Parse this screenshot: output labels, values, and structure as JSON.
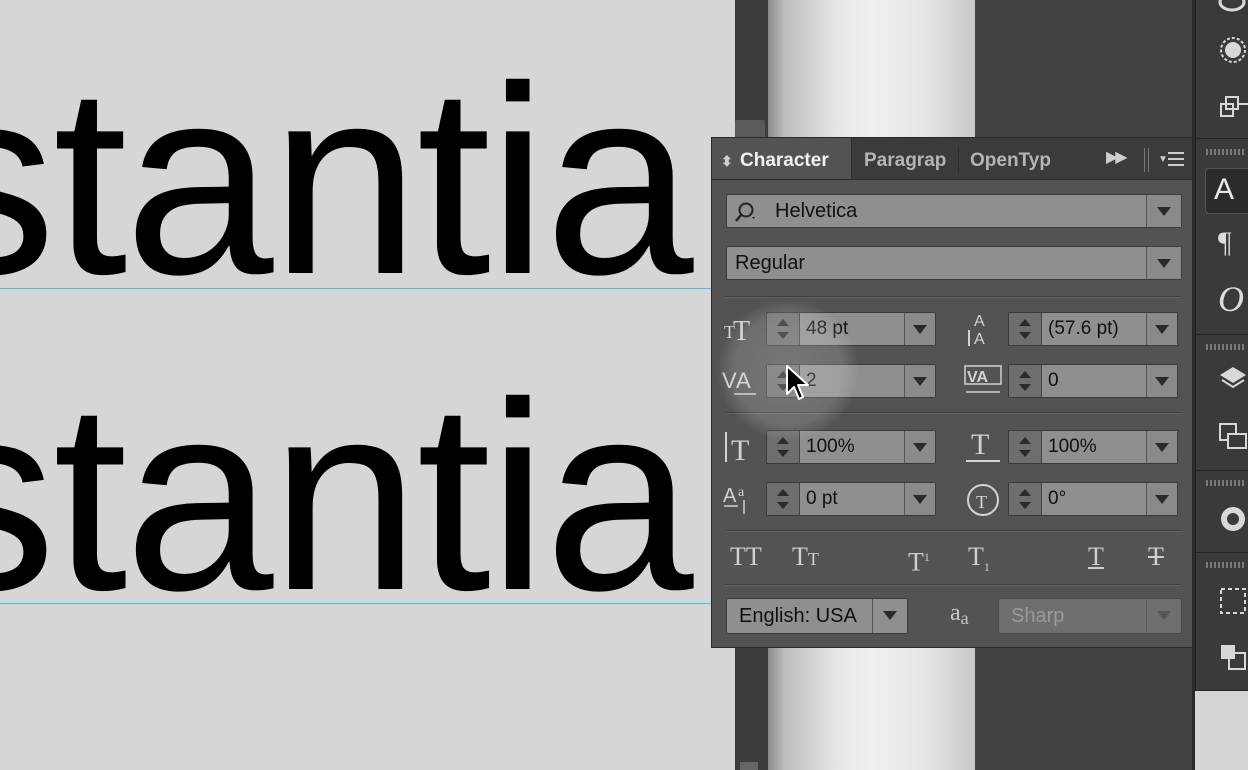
{
  "artboard": {
    "line1": "stantia",
    "line2": "stantia",
    "guide_color": "#3ec7d4"
  },
  "character_panel": {
    "tabs": {
      "character": "Character",
      "paragraph": "Paragrap",
      "opentype": "OpenTyp"
    },
    "font_family": "Helvetica",
    "font_style": "Regular",
    "font_size": "48 pt",
    "leading": "(57.6 pt)",
    "kerning": "2",
    "tracking": "0",
    "vertical_scale": "100%",
    "horizontal_scale": "100%",
    "baseline_shift": "0 pt",
    "character_rotation": "0°",
    "format_buttons": [
      "all-caps",
      "small-caps",
      "superscript",
      "subscript",
      "underline",
      "strikethrough"
    ],
    "language": "English: USA",
    "anti_aliasing": "Sharp"
  },
  "dock": {
    "icons": [
      "appearance-icon",
      "symbols-icon",
      "transform-icon",
      "character-icon",
      "paragraph-icon",
      "opentype-icon",
      "layers-icon",
      "artboards-icon",
      "color-guide-icon",
      "transparency-icon",
      "pathfinder-icon"
    ]
  }
}
